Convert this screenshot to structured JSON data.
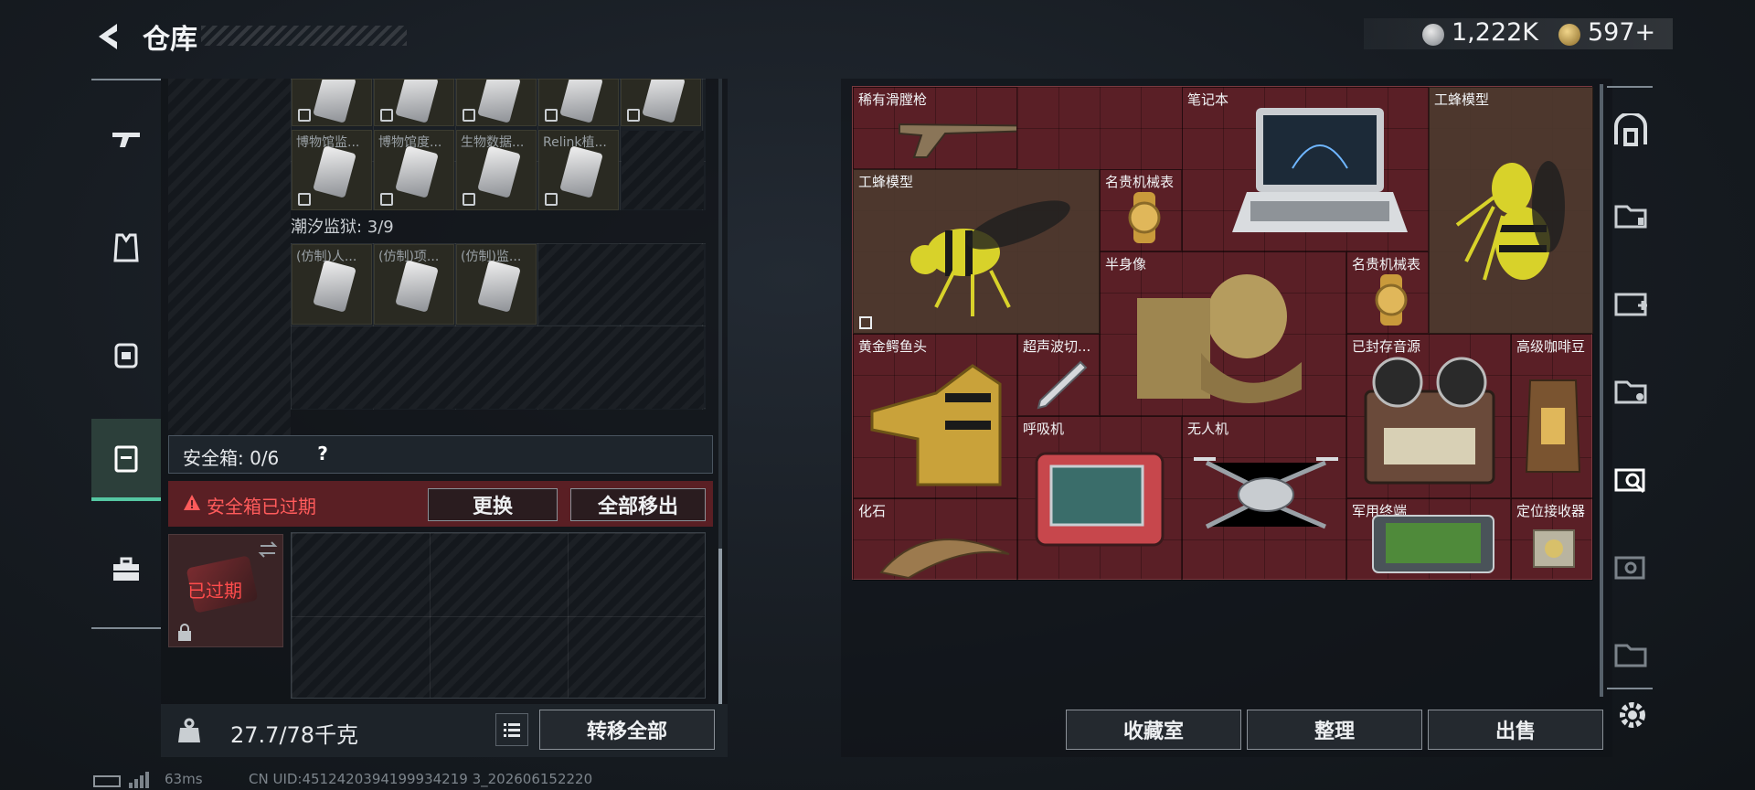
{
  "header": {
    "title": "仓库",
    "currency_value": "1,222K",
    "premium_value": "597+"
  },
  "left_panel": {
    "top_row_labels": [
      "博物馆监...",
      "博物馆度...",
      "生物数据...",
      "Relink植..."
    ],
    "prison_label": "潮汐监狱: 3/9",
    "prison_row_labels": [
      "(仿制)人...",
      "(仿制)项...",
      "(仿制)监..."
    ],
    "safe_label": "安全箱: 0/6",
    "help_label": "?",
    "expired_warning": "安全箱已过期",
    "replace_button": "更换",
    "move_all_button": "全部移出",
    "safe_slot_status": "已过期",
    "weight_value": "27.7/78千克",
    "transfer_all_button": "转移全部"
  },
  "stash_items": [
    {
      "name": "稀有滑膛枪"
    },
    {
      "name": "笔记本"
    },
    {
      "name": "工蜂模型"
    },
    {
      "name": "工蜂模型"
    },
    {
      "name": "名贵机械表"
    },
    {
      "name": "半身像"
    },
    {
      "name": "名贵机械表"
    },
    {
      "name": "黄金鳄鱼头"
    },
    {
      "name": "超声波切..."
    },
    {
      "name": "已封存音源"
    },
    {
      "name": "高级咖啡豆"
    },
    {
      "name": "呼吸机"
    },
    {
      "name": "无人机"
    },
    {
      "name": "化石"
    },
    {
      "name": "军用终端"
    },
    {
      "name": "定位接收器"
    }
  ],
  "bottom_buttons": {
    "collection": "收藏室",
    "organize": "整理",
    "sell": "出售"
  },
  "footer": {
    "ping": "63ms",
    "uid": "CN UID:4512420394199934219 3_202606152220"
  },
  "colors": {
    "accent_green": "#55c7a2",
    "warning_red": "#ff5b5b",
    "stash_red": "#5a1f26"
  }
}
